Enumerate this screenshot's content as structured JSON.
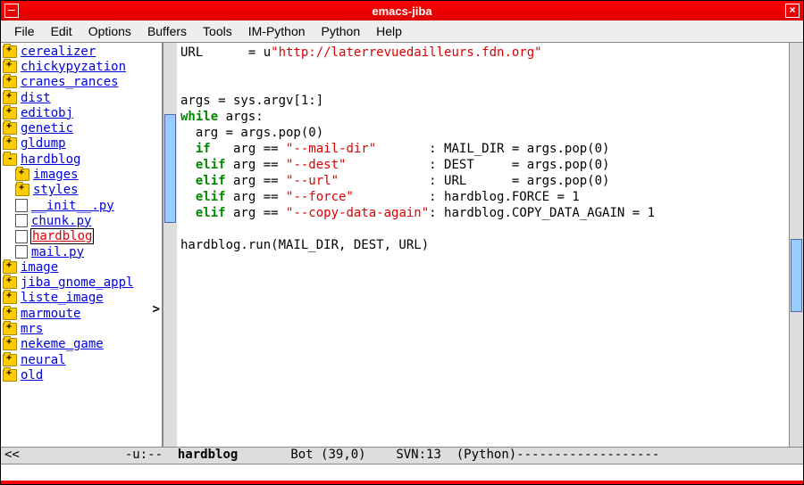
{
  "title": "emacs-jiba",
  "menu": [
    "File",
    "Edit",
    "Options",
    "Buffers",
    "Tools",
    "IM-Python",
    "Python",
    "Help"
  ],
  "tree": [
    {
      "label": "cerealizer",
      "type": "folder",
      "state": "plus",
      "indent": 0
    },
    {
      "label": "chickypyzation",
      "type": "folder",
      "state": "plus",
      "indent": 0
    },
    {
      "label": "cranes_rances",
      "type": "folder",
      "state": "plus",
      "indent": 0
    },
    {
      "label": "dist",
      "type": "folder",
      "state": "plus",
      "indent": 0
    },
    {
      "label": "editobj",
      "type": "folder",
      "state": "plus",
      "indent": 0
    },
    {
      "label": "genetic",
      "type": "folder",
      "state": "plus",
      "indent": 0
    },
    {
      "label": "gldump",
      "type": "folder",
      "state": "plus",
      "indent": 0
    },
    {
      "label": "hardblog",
      "type": "folder",
      "state": "minus",
      "indent": 0
    },
    {
      "label": "images",
      "type": "folder",
      "state": "plus",
      "indent": 1
    },
    {
      "label": "styles",
      "type": "folder",
      "state": "plus",
      "indent": 1
    },
    {
      "label": "__init__.py",
      "type": "file",
      "indent": 1
    },
    {
      "label": "chunk.py",
      "type": "file",
      "indent": 1
    },
    {
      "label": "hardblog",
      "type": "file",
      "indent": 1,
      "selected": true
    },
    {
      "label": "mail.py",
      "type": "file",
      "indent": 1
    },
    {
      "label": "image",
      "type": "folder",
      "state": "plus",
      "indent": 0
    },
    {
      "label": "jiba_gnome_appl",
      "type": "folder",
      "state": "plus",
      "indent": 0,
      "trunc": true
    },
    {
      "label": "liste_image",
      "type": "folder",
      "state": "plus",
      "indent": 0
    },
    {
      "label": "marmoute",
      "type": "folder",
      "state": "plus",
      "indent": 0
    },
    {
      "label": "mrs",
      "type": "folder",
      "state": "plus",
      "indent": 0
    },
    {
      "label": "nekeme_game",
      "type": "folder",
      "state": "plus",
      "indent": 0
    },
    {
      "label": "neural",
      "type": "folder",
      "state": "plus",
      "indent": 0
    },
    {
      "label": "old",
      "type": "folder",
      "state": "plus",
      "indent": 0
    }
  ],
  "code": {
    "l1a": "URL      = u",
    "l1b": "\"http://laterrevuedailleurs.fdn.org\"",
    "l3": "args = sys.argv[1:]",
    "l4a": "while",
    "l4b": " args:",
    "l5": "  arg = args.pop(0)",
    "l6a": "  ",
    "l6k": "if",
    "l6b": "   arg == ",
    "l6s": "\"--mail-dir\"",
    "l6c": "       : MAIL_DIR = args.pop(0)",
    "l7a": "  ",
    "l7k": "elif",
    "l7b": " arg == ",
    "l7s": "\"--dest\"",
    "l7c": "           : DEST     = args.pop(0)",
    "l8a": "  ",
    "l8k": "elif",
    "l8b": " arg == ",
    "l8s": "\"--url\"",
    "l8c": "            : URL      = args.pop(0)",
    "l9a": "  ",
    "l9k": "elif",
    "l9b": " arg == ",
    "l9s": "\"--force\"",
    "l9c": "          : hardblog.FORCE = 1",
    "l10a": "  ",
    "l10k": "elif",
    "l10b": " arg == ",
    "l10s": "\"--copy-data-again\"",
    "l10c": ": hardblog.COPY_DATA_AGAIN = 1",
    "l12": "hardblog.run(MAIL_DIR, DEST, URL)"
  },
  "modeline": {
    "pre": "<<              -u:--  ",
    "buf": "hardblog",
    "post": "       Bot (39,0)    SVN:13  (Python)-------------------"
  },
  "arrow": ">"
}
